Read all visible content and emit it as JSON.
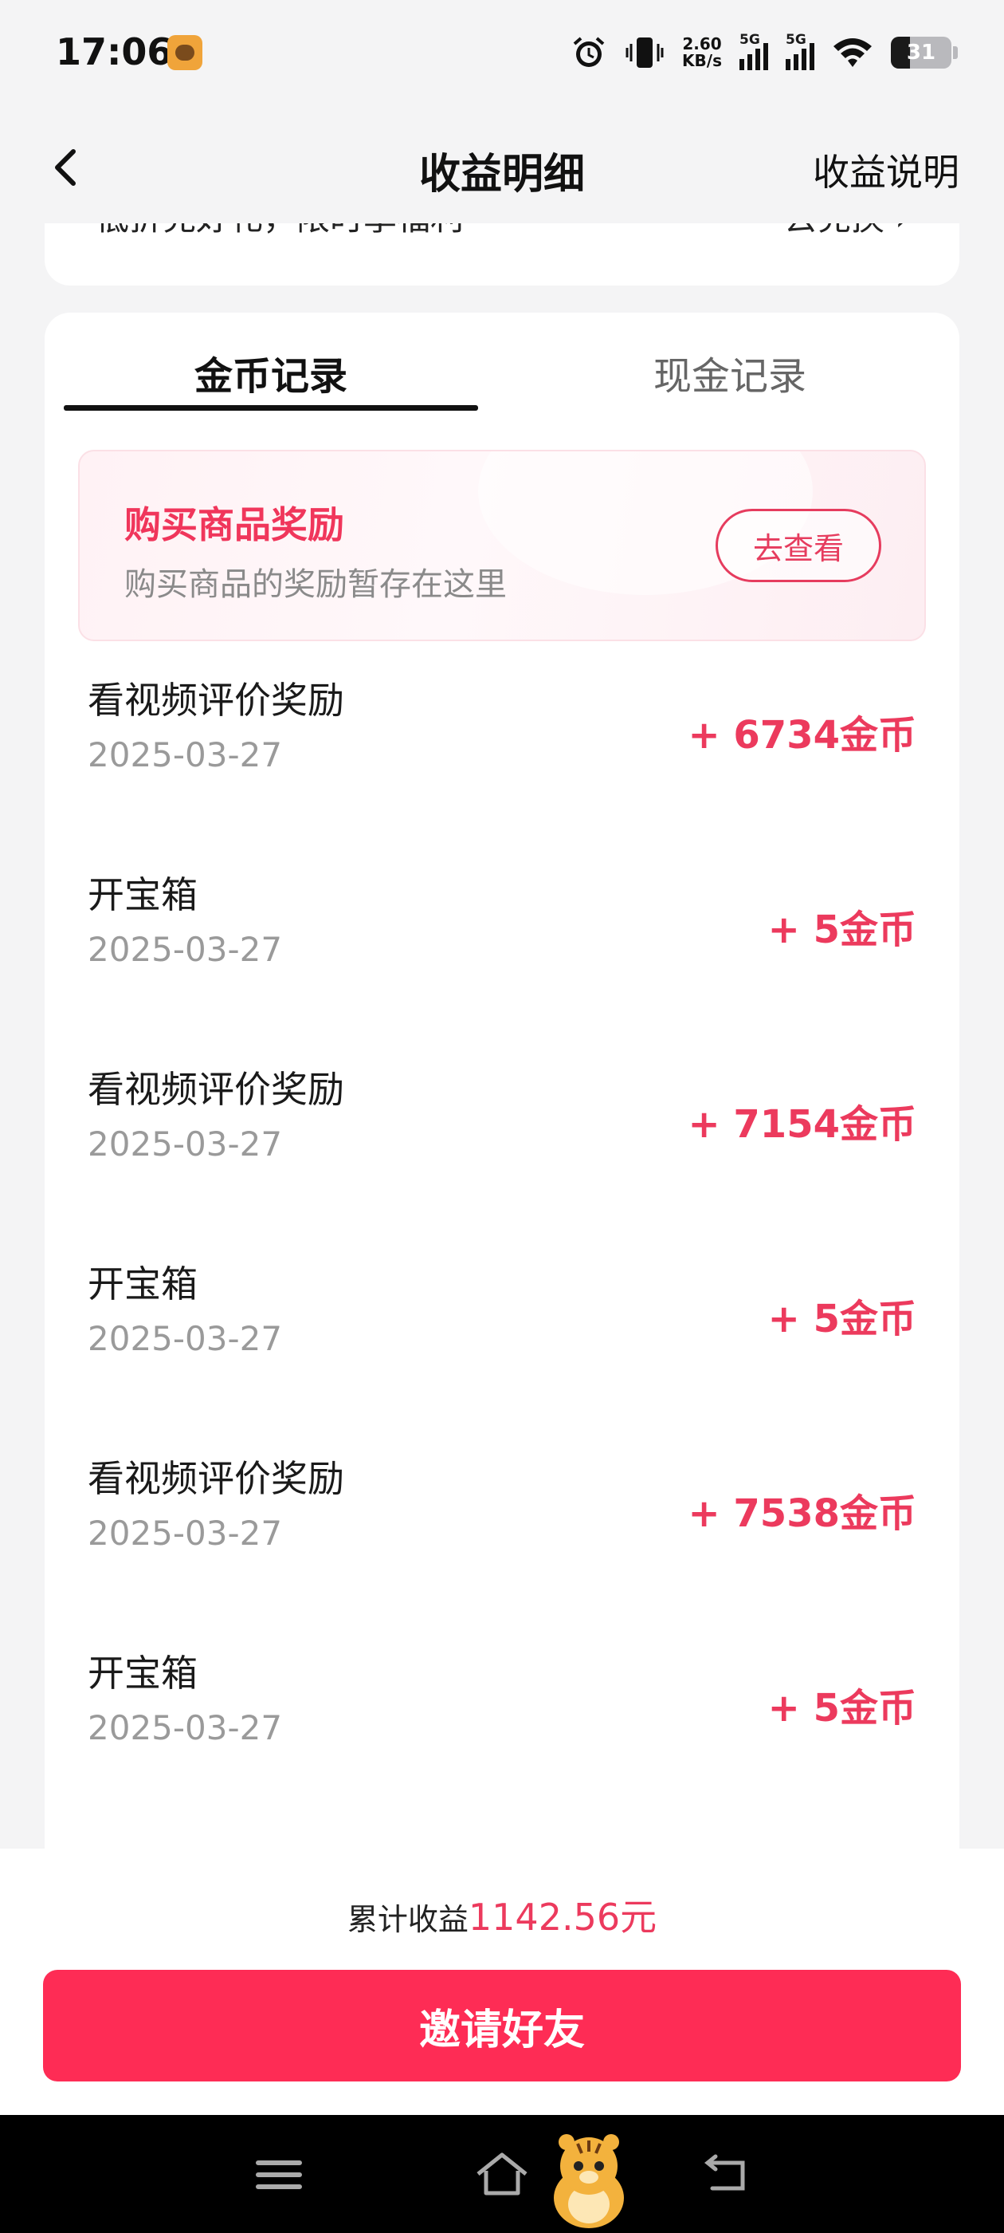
{
  "status_bar": {
    "time": "17:06",
    "net_speed_value": "2.60",
    "net_speed_unit": "KB/s",
    "sim1_label": "5G",
    "sim2_label": "5G",
    "battery_level": "31",
    "icons": [
      "alarm-icon",
      "vibrate-icon",
      "signal-icon",
      "wifi-icon",
      "battery-icon"
    ]
  },
  "nav": {
    "title": "收益明细",
    "right_link": "收益说明"
  },
  "promo": {
    "text": "低折兑好礼，限时享福利",
    "link": "去兑换"
  },
  "tabs": [
    {
      "label": "金币记录",
      "active": true
    },
    {
      "label": "现金记录",
      "active": false
    }
  ],
  "banner": {
    "title": "购买商品奖励",
    "subtitle": "购买商品的奖励暂存在这里",
    "button": "去查看"
  },
  "records": [
    {
      "name": "看视频评价奖励",
      "date": "2025-03-27",
      "amount": "+ 6734金币"
    },
    {
      "name": "开宝箱",
      "date": "2025-03-27",
      "amount": "+ 5金币"
    },
    {
      "name": "看视频评价奖励",
      "date": "2025-03-27",
      "amount": "+ 7154金币"
    },
    {
      "name": "开宝箱",
      "date": "2025-03-27",
      "amount": "+ 5金币"
    },
    {
      "name": "看视频评价奖励",
      "date": "2025-03-27",
      "amount": "+ 7538金币"
    },
    {
      "name": "开宝箱",
      "date": "2025-03-27",
      "amount": "+ 5金币"
    }
  ],
  "footer": {
    "total_label": "累计收益",
    "total_value": "1142.56元",
    "invite_button": "邀请好友"
  },
  "colors": {
    "accent": "#ec3a5d",
    "primary_button": "#fe2c55",
    "background": "#f4f4f5"
  }
}
